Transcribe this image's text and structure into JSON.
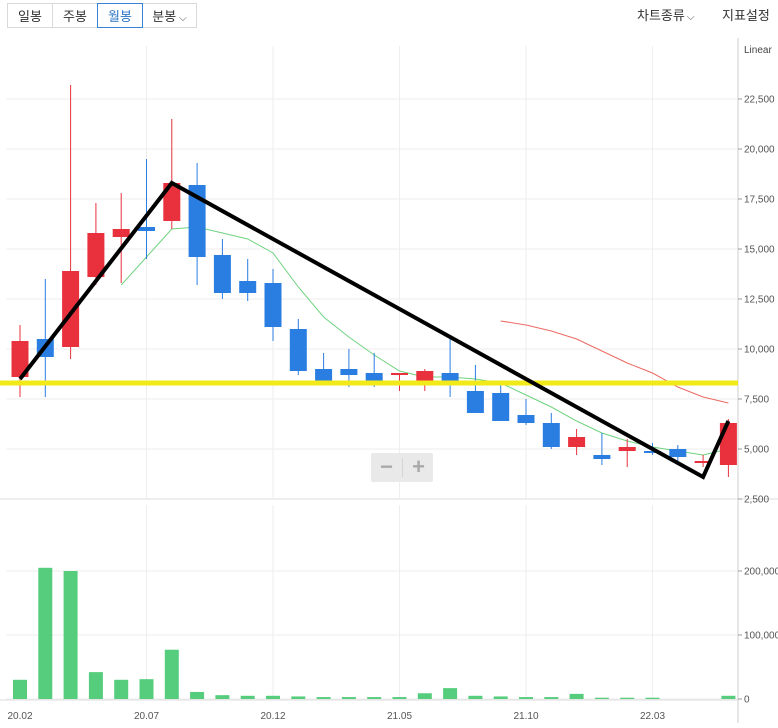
{
  "toolbar": {
    "periods": [
      "일봉",
      "주봉",
      "월봉",
      "분봉"
    ],
    "active_period": "월봉",
    "chart_type_label": "차트종류",
    "settings_label": "지표설정",
    "chevron": "⌵"
  },
  "zoom": {
    "minus": "−",
    "plus": "+"
  },
  "colors": {
    "up": "#e8313d",
    "down": "#2a7de1",
    "ma_short": "#6fd37f",
    "ma_long": "#ec6a63",
    "volume": "#55cd7c",
    "trend_line": "#000000",
    "support_line": "#f2ea18",
    "grid": "#eeeeee",
    "axis": "#555555"
  },
  "chart_data": [
    {
      "type": "candlestick",
      "scale": "Linear",
      "x": [
        "20.02",
        "20.03",
        "20.04",
        "20.05",
        "20.06",
        "20.07",
        "20.08",
        "20.09",
        "20.10",
        "20.11",
        "20.12",
        "21.01",
        "21.02",
        "21.03",
        "21.04",
        "21.05",
        "21.06",
        "21.07",
        "21.08",
        "21.09",
        "21.10",
        "21.11",
        "21.12",
        "22.01",
        "22.02",
        "22.03",
        "22.04",
        "22.05",
        "22.06"
      ],
      "x_ticks": [
        "20.02",
        "20.07",
        "20.12",
        "21.05",
        "21.10",
        "22.03"
      ],
      "open": [
        8600,
        10500,
        10100,
        13600,
        15600,
        16100,
        16400,
        18200,
        14700,
        13400,
        13300,
        11000,
        9000,
        9000,
        8800,
        8700,
        8200,
        8800,
        7900,
        7800,
        6700,
        6300,
        5100,
        4700,
        4900,
        4900,
        5000,
        4300,
        4200
      ],
      "high": [
        11200,
        13500,
        23200,
        17300,
        17800,
        19500,
        21500,
        19300,
        15500,
        14500,
        14000,
        11500,
        9800,
        10000,
        9800,
        8800,
        9000,
        10500,
        9200,
        8200,
        7500,
        6800,
        6000,
        5800,
        5500,
        5300,
        5200,
        4700,
        6500
      ],
      "low": [
        7600,
        7600,
        9500,
        13200,
        13300,
        14500,
        16000,
        13200,
        12500,
        12400,
        10400,
        8700,
        8300,
        8100,
        8100,
        7900,
        7900,
        7600,
        7600,
        6900,
        6200,
        5000,
        4700,
        4200,
        4100,
        4700,
        4400,
        4100,
        3600
      ],
      "close": [
        10400,
        9600,
        13900,
        15800,
        16000,
        15900,
        18300,
        14600,
        12800,
        12800,
        11100,
        8900,
        8400,
        8700,
        8200,
        8800,
        8900,
        8300,
        6800,
        6400,
        6300,
        5100,
        5600,
        4500,
        5100,
        4800,
        4600,
        4400,
        6300
      ],
      "ma_short": [
        null,
        null,
        null,
        null,
        13200,
        14600,
        16000,
        16100,
        15800,
        15500,
        14800,
        13100,
        11600,
        10600,
        9700,
        8900,
        8600,
        8600,
        8500,
        8300,
        7700,
        7100,
        6400,
        5800,
        5400,
        5100,
        4900,
        4700,
        5000
      ],
      "ma_long": [
        null,
        null,
        null,
        null,
        null,
        null,
        null,
        null,
        null,
        null,
        null,
        null,
        null,
        null,
        null,
        null,
        null,
        null,
        null,
        11400,
        11200,
        10900,
        10500,
        9900,
        9300,
        8800,
        8100,
        7600,
        7300
      ],
      "trend_line": [
        {
          "x": "20.02",
          "y": 8500
        },
        {
          "x": "20.08",
          "y": 18300
        },
        {
          "x": "22.05",
          "y": 3600
        },
        {
          "x": "22.06",
          "y": 6400
        }
      ],
      "support_level": 8300,
      "y_ticks": [
        "2,500",
        "5,000",
        "7,500",
        "10,000",
        "12,500",
        "15,000",
        "17,500",
        "20,000",
        "22,500"
      ],
      "ylim": [
        2500,
        25000
      ]
    },
    {
      "type": "bar",
      "x": [
        "20.02",
        "20.03",
        "20.04",
        "20.05",
        "20.06",
        "20.07",
        "20.08",
        "20.09",
        "20.10",
        "20.11",
        "20.12",
        "21.01",
        "21.02",
        "21.03",
        "21.04",
        "21.05",
        "21.06",
        "21.07",
        "21.08",
        "21.09",
        "21.10",
        "21.11",
        "21.12",
        "22.01",
        "22.02",
        "22.03",
        "22.04",
        "22.05",
        "22.06"
      ],
      "values": [
        30000,
        205000,
        200000,
        42000,
        30000,
        31000,
        77000,
        11000,
        6000,
        5000,
        5000,
        4000,
        3000,
        3000,
        3000,
        3000,
        9000,
        17000,
        5000,
        4000,
        3000,
        3000,
        8000,
        2000,
        2000,
        2000,
        0,
        0,
        5000
      ],
      "y_ticks": [
        "0",
        "100,000",
        "200,000"
      ],
      "ylim": [
        0,
        240000
      ]
    }
  ]
}
